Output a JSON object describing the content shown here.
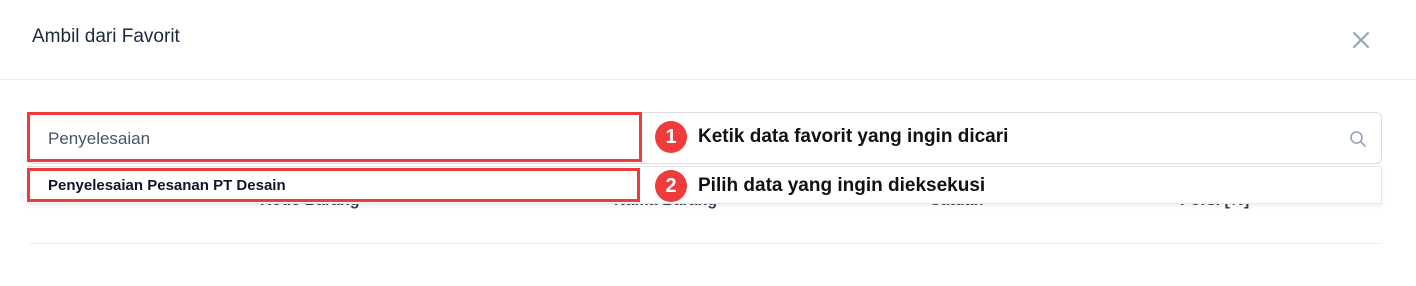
{
  "modal": {
    "title": "Ambil dari Favorit",
    "close_icon": "close-icon"
  },
  "search": {
    "value": "Penyelesaian",
    "icon": "search-icon"
  },
  "table": {
    "columns": [
      "Kode Barang",
      "Nama Barang",
      "Satuan",
      "Porsi [%]"
    ]
  },
  "dropdown": {
    "items": [
      "Penyelesaian Pesanan PT Desain"
    ]
  },
  "annotations": [
    {
      "number": "1",
      "text": "Ketik data favorit yang ingin dicari"
    },
    {
      "number": "2",
      "text": "Pilih data yang ingin dieksekusi"
    }
  ],
  "colors": {
    "annotation_red": "#ef3b3b"
  }
}
